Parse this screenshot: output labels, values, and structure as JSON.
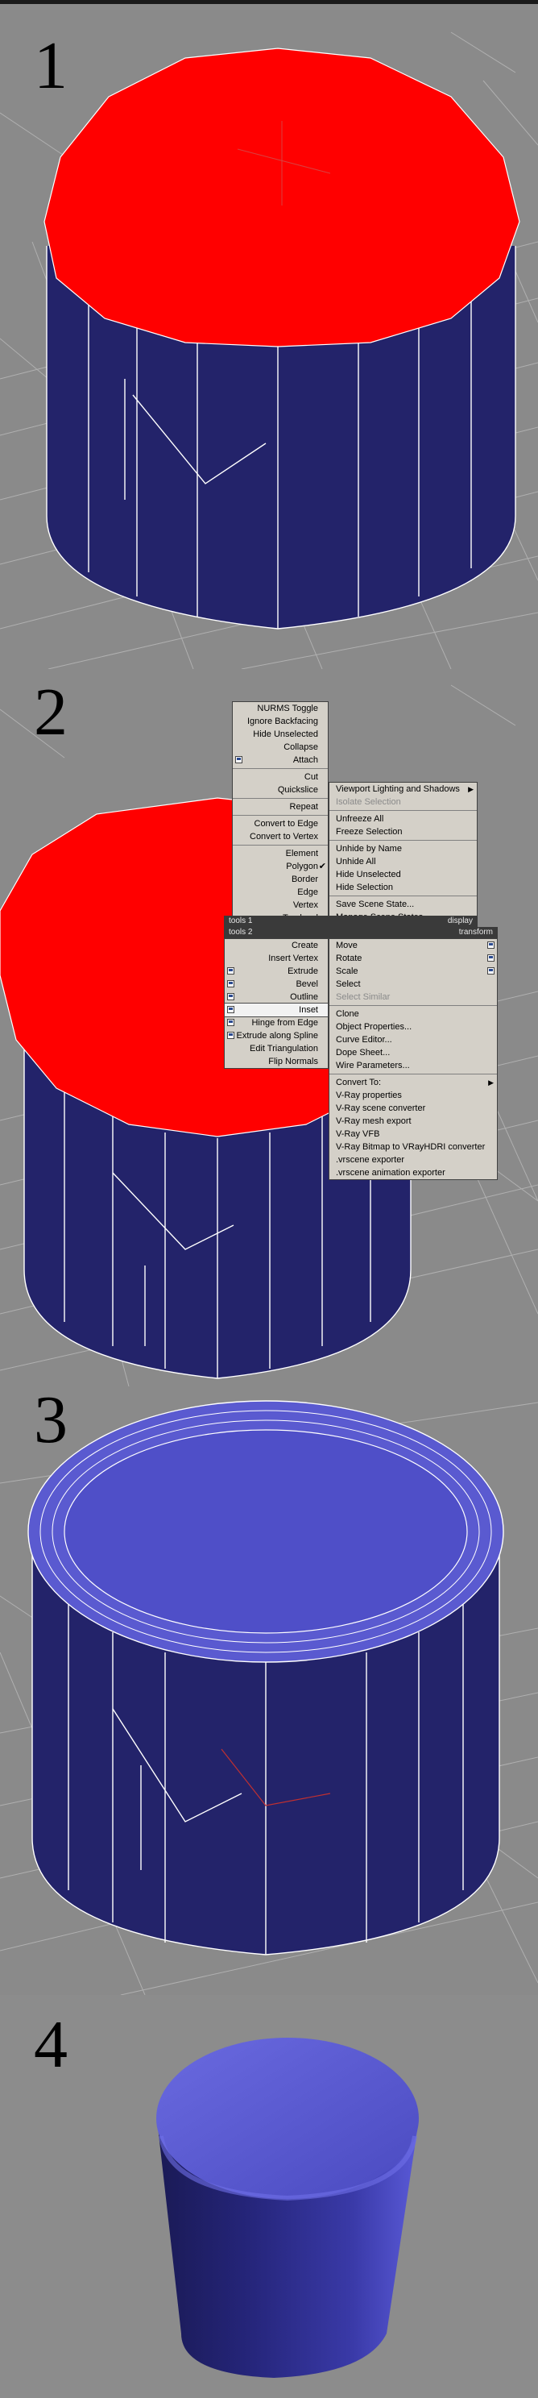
{
  "steps": {
    "step1": "1",
    "step2": "2",
    "step3": "3",
    "step4": "4"
  },
  "colors": {
    "viewport_bg": "#8a8a8a",
    "cylinder_side": "#23236a",
    "selected_face": "#ff0000",
    "cylinder_light": "#5a5ad0",
    "menu_bg": "#d4d0c8",
    "menu_header": "#3a3a3a"
  },
  "menu": {
    "top_left": [
      "NURMS Toggle",
      "Ignore Backfacing",
      "Hide Unselected",
      "Collapse",
      "Attach",
      "Cut",
      "Quickslice",
      "Repeat",
      "Convert to Edge",
      "Convert to Vertex",
      "Element",
      "Polygon",
      "Border",
      "Edge",
      "Vertex",
      "Top-level"
    ],
    "top_right": [
      "Viewport Lighting and Shadows",
      "Isolate Selection",
      "Unfreeze All",
      "Freeze Selection",
      "Unhide by Name",
      "Unhide All",
      "Hide Unselected",
      "Hide Selection",
      "Save Scene State...",
      "Manage Scene States..."
    ],
    "headers": {
      "tools1": "tools 1",
      "display": "display",
      "tools2": "tools 2",
      "transform": "transform"
    },
    "bottom_left": [
      "Create",
      "Insert Vertex",
      "Extrude",
      "Bevel",
      "Outline",
      "Inset",
      "Hinge from Edge",
      "Extrude along Spline",
      "Edit Triangulation",
      "Flip Normals"
    ],
    "bottom_right": [
      "Move",
      "Rotate",
      "Scale",
      "Select",
      "Select Similar",
      "Clone",
      "Object Properties...",
      "Curve Editor...",
      "Dope Sheet...",
      "Wire Parameters...",
      "Convert To:",
      "V-Ray properties",
      "V-Ray scene converter",
      "V-Ray mesh export",
      "V-Ray VFB",
      "V-Ray Bitmap to VRayHDRI converter",
      ".vrscene exporter",
      ".vrscene animation exporter"
    ]
  }
}
